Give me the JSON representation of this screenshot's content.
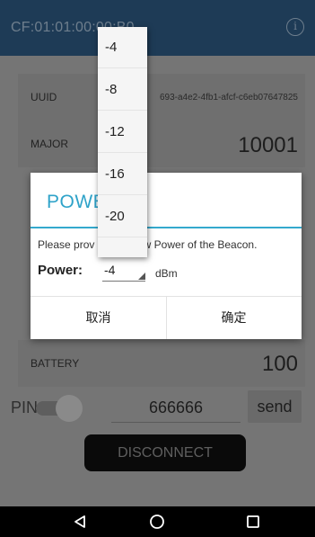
{
  "appbar": {
    "title": "CF:01:01:00:00:B0",
    "info_icon": "info-icon"
  },
  "rows": {
    "uuid": {
      "label": "UUID",
      "value": "693-a4e2-4fb1-afcf-c6eb07647825"
    },
    "major": {
      "label": "MAJOR",
      "value": "10001"
    },
    "battery": {
      "label": "BATTERY",
      "value": "100"
    }
  },
  "pin": {
    "label": "PIN:",
    "value": "666666",
    "send_label": "send",
    "toggle_on": false
  },
  "disconnect_label": "DISCONNECT",
  "dialog": {
    "title": "POWE",
    "message_left": "Please prov",
    "message_right": "ew Power of the Beacon.",
    "power_label": "Power:",
    "power_value": "-4",
    "unit": "dBm",
    "cancel_label": "取消",
    "ok_label": "确定"
  },
  "dropdown": {
    "options": [
      "-4",
      "-8",
      "-12",
      "-16",
      "-20"
    ]
  },
  "navbar": {
    "back_icon": "back-triangle-icon",
    "home_icon": "home-circle-icon",
    "recent_icon": "recent-square-icon"
  },
  "colors": {
    "accent": "#2fa3c9",
    "appbar": "#1e3b56",
    "dim_bg": "#757575"
  }
}
